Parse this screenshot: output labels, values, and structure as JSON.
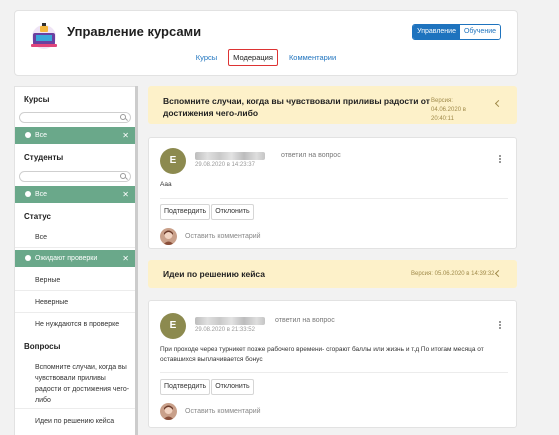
{
  "header": {
    "title": "Управление курсами",
    "mode_switch": [
      "Управление",
      "Обучение"
    ],
    "tabs": [
      "Курсы",
      "Модерация",
      "Комментарии"
    ]
  },
  "sidebar": {
    "courses_heading": "Курсы",
    "courses_chip": "Все",
    "students_heading": "Студенты",
    "students_chip": "Все",
    "status_heading": "Статус",
    "status_all": "Все",
    "status_chip": "Ожидают проверки",
    "status_correct": "Верные",
    "status_wrong": "Неверные",
    "status_no_check": "Не нуждаются в проверке",
    "questions_heading": "Вопросы",
    "question_1": "Вспомните случаи, когда вы чувствовали приливы радости от достижения чего-либо",
    "question_2": "Идеи по решению кейса"
  },
  "questions": [
    {
      "title": "Вспомните случаи, когда вы чувствовали приливы радости от достижения чего-либо",
      "version": "Версия: 04.06.2020 в 20:40:11",
      "answer": {
        "avatar_letter": "E",
        "answered_label": "ответил на вопрос",
        "timestamp": "29.08.2020 в 14:23:37",
        "text": "Ааа",
        "approve": "Подтвердить",
        "reject": "Отклонить",
        "comment_placeholder": "Оставить комментарий"
      }
    },
    {
      "title": "Идеи по решению кейса",
      "version": "Версия: 05.06.2020 в 14:39:32",
      "answer": {
        "avatar_letter": "E",
        "answered_label": "ответил на вопрос",
        "timestamp": "29.08.2020 в 21:33:52",
        "text": "При проходе через турникет позже рабочего времени- сгорают баллы или жизнь и т.д По итогам месяца от оставшихся выплачивается бонус",
        "approve": "Подтвердить",
        "reject": "Отклонить",
        "comment_placeholder": "Оставить комментарий"
      }
    }
  ],
  "colors": {
    "accent": "#1e73be",
    "chip": "#6aa88a",
    "banner": "#fdf1c9",
    "avatar": "#8c8a4f",
    "highlight": "#dd3333"
  },
  "icons": [
    "course-logo-icon",
    "search-icon",
    "check-circle-icon",
    "close-icon",
    "chevron-left-icon",
    "more-vertical-icon",
    "user-avatar-icon"
  ]
}
